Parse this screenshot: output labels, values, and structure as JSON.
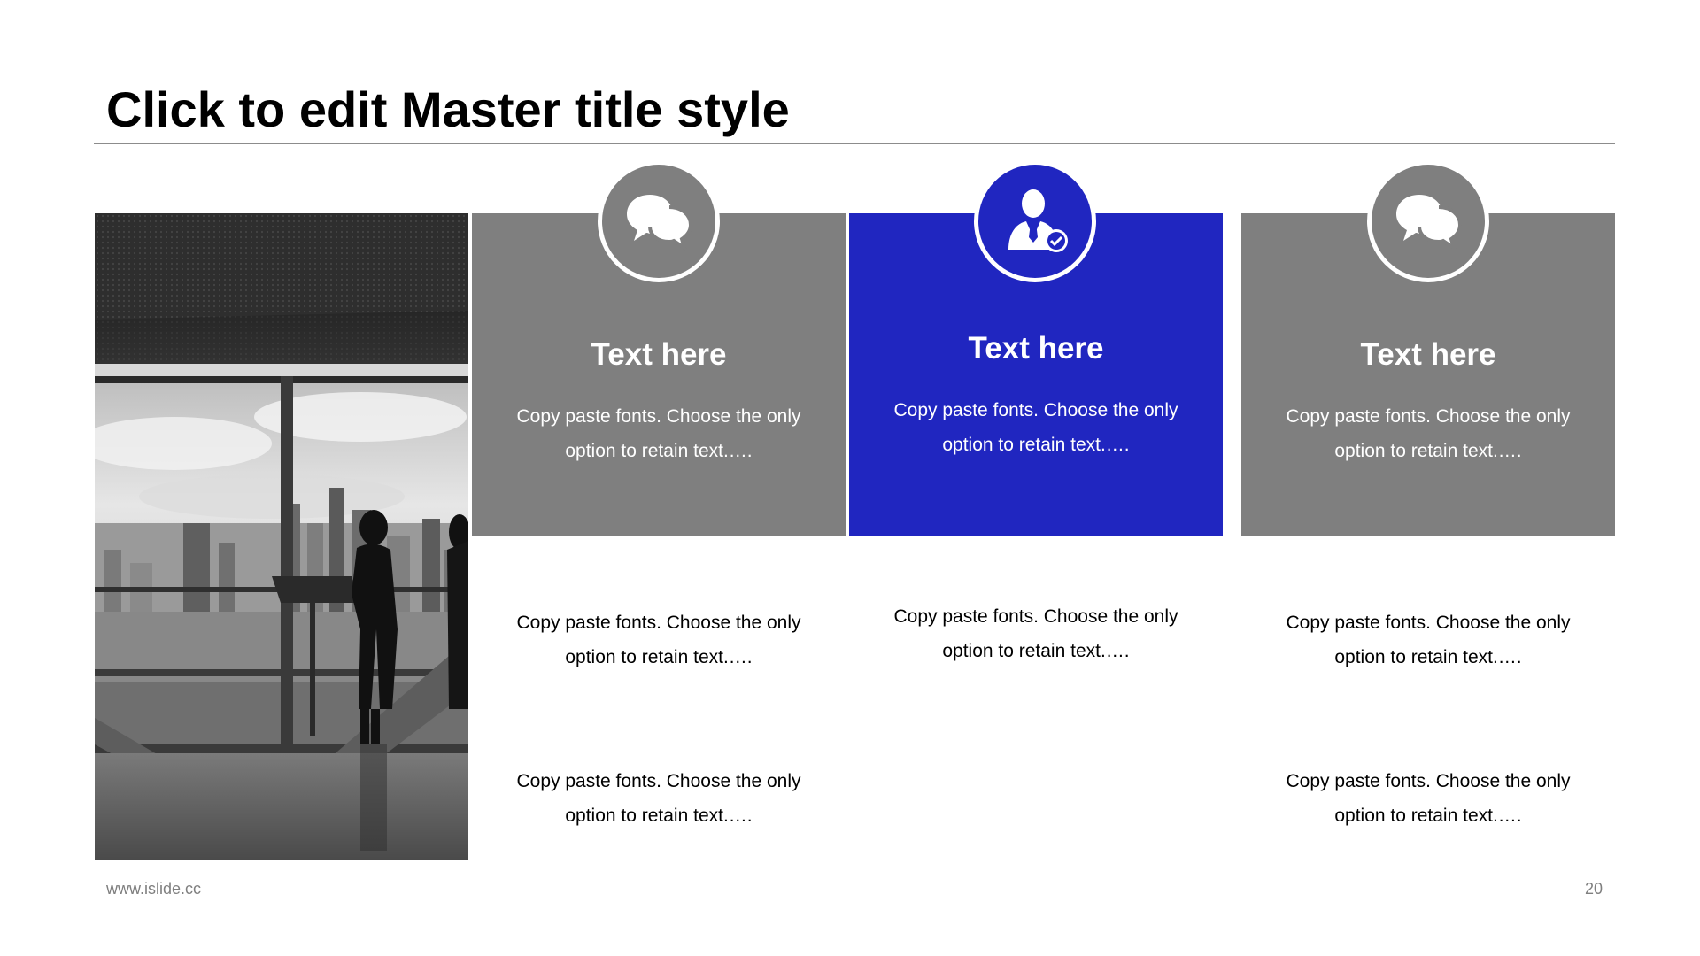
{
  "slide": {
    "title": "Click to edit Master title style",
    "footer_url": "www.islide.cc",
    "page_number": "20"
  },
  "colors": {
    "gray": "#7f7f7f",
    "blue": "#2026c0",
    "text_dark": "#000000",
    "footer": "#7f7f7f"
  },
  "photo": {
    "description_icon": "office-window-city-photo"
  },
  "cards": [
    {
      "heading": "Text here",
      "text": "Copy paste fonts. Choose the only option to retain text.….",
      "icon": "speech-bubbles-icon",
      "color": "gray"
    },
    {
      "heading": "Text here",
      "text": "Copy paste fonts. Choose the only option to retain text.….",
      "icon": "businessman-check-icon",
      "color": "blue"
    },
    {
      "heading": "Text here",
      "text": "Copy paste fonts. Choose the only option to retain text.….",
      "icon": "speech-bubbles-icon",
      "color": "gray"
    }
  ],
  "columns": [
    {
      "items": [
        "Copy paste fonts. Choose the only option to retain text.….",
        "Copy paste fonts. Choose the only option to retain text.…."
      ]
    },
    {
      "items": [
        "Copy paste fonts. Choose the only option to retain text.…."
      ]
    },
    {
      "items": [
        "Copy paste fonts. Choose the only option to retain text.….",
        "Copy paste fonts. Choose the only option to retain text.…."
      ]
    }
  ]
}
